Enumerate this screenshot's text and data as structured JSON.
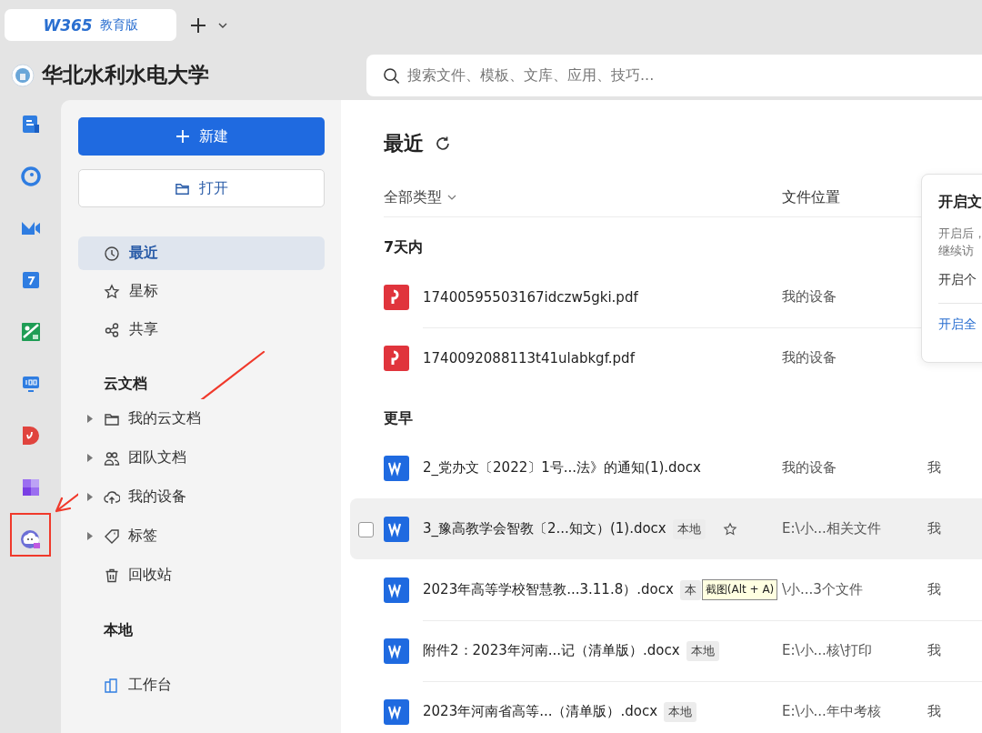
{
  "tab": {
    "logo": "W365",
    "label": "教育版"
  },
  "org": {
    "name": "华北水利水电大学"
  },
  "search": {
    "placeholder": "搜索文件、模板、文库、应用、技巧..."
  },
  "sidebar": {
    "new_button": "新建",
    "open_button": "打开",
    "nav": [
      {
        "label": "最近",
        "selected": true
      },
      {
        "label": "星标",
        "selected": false
      },
      {
        "label": "共享",
        "selected": false
      }
    ],
    "cloud": {
      "title": "云文档",
      "items": [
        {
          "label": "我的云文档",
          "kind": "tree",
          "expanded": false
        },
        {
          "label": "团队文档",
          "kind": "tree",
          "expanded": false
        },
        {
          "label": "我的设备",
          "kind": "tree",
          "expanded": false
        },
        {
          "label": "标签",
          "kind": "tree",
          "expanded": false
        },
        {
          "label": "回收站",
          "kind": "plain"
        }
      ]
    },
    "local": {
      "title": "本地",
      "items": [
        {
          "label": "工作台"
        }
      ]
    }
  },
  "main": {
    "title": "最近",
    "filter": "全部类型",
    "column_location": "文件位置",
    "sections": [
      {
        "title": "7天内",
        "files": [
          {
            "kind": "pdf",
            "name": "17400595503167idczw5gki.pdf",
            "location": "我的设备",
            "hovered": false
          },
          {
            "kind": "pdf",
            "name": "1740092088113t41ulabkgf.pdf",
            "location": "我的设备",
            "hovered": false
          }
        ]
      },
      {
        "title": "更早",
        "files": [
          {
            "kind": "word",
            "name": "2_党办文〔2022〕1号...法》的通知(1).docx",
            "location": "我的设备",
            "owner": "我",
            "hovered": false
          },
          {
            "kind": "word",
            "name": "3_豫高教学会智教〔2...知文）(1).docx",
            "tag": "本地",
            "starred": false,
            "checked": false,
            "location": "E:\\小...相关文件",
            "owner": "我",
            "hovered": true
          },
          {
            "kind": "word",
            "name": "2023年高等学校智慧教...3.11.8）.docx",
            "tag": "本",
            "tooltip": "截图(Alt + A)",
            "location": "\\小...3个文件",
            "owner": "我",
            "hovered": false
          },
          {
            "kind": "word",
            "name": "附件2：2023年河南...记（清单版）.docx",
            "tag": "本地",
            "location": "E:\\小...核\\打印",
            "owner": "我",
            "hovered": false
          },
          {
            "kind": "word",
            "name": "2023年河南省高等...（清单版）.docx",
            "tag": "本地",
            "location": "E:\\小...年中考核",
            "owner": "我",
            "hovered": false
          }
        ]
      }
    ]
  },
  "popover": {
    "title": "开启文",
    "lines": [
      "开启后，",
      "继续访"
    ],
    "option": "开启个",
    "link": "开启全"
  }
}
